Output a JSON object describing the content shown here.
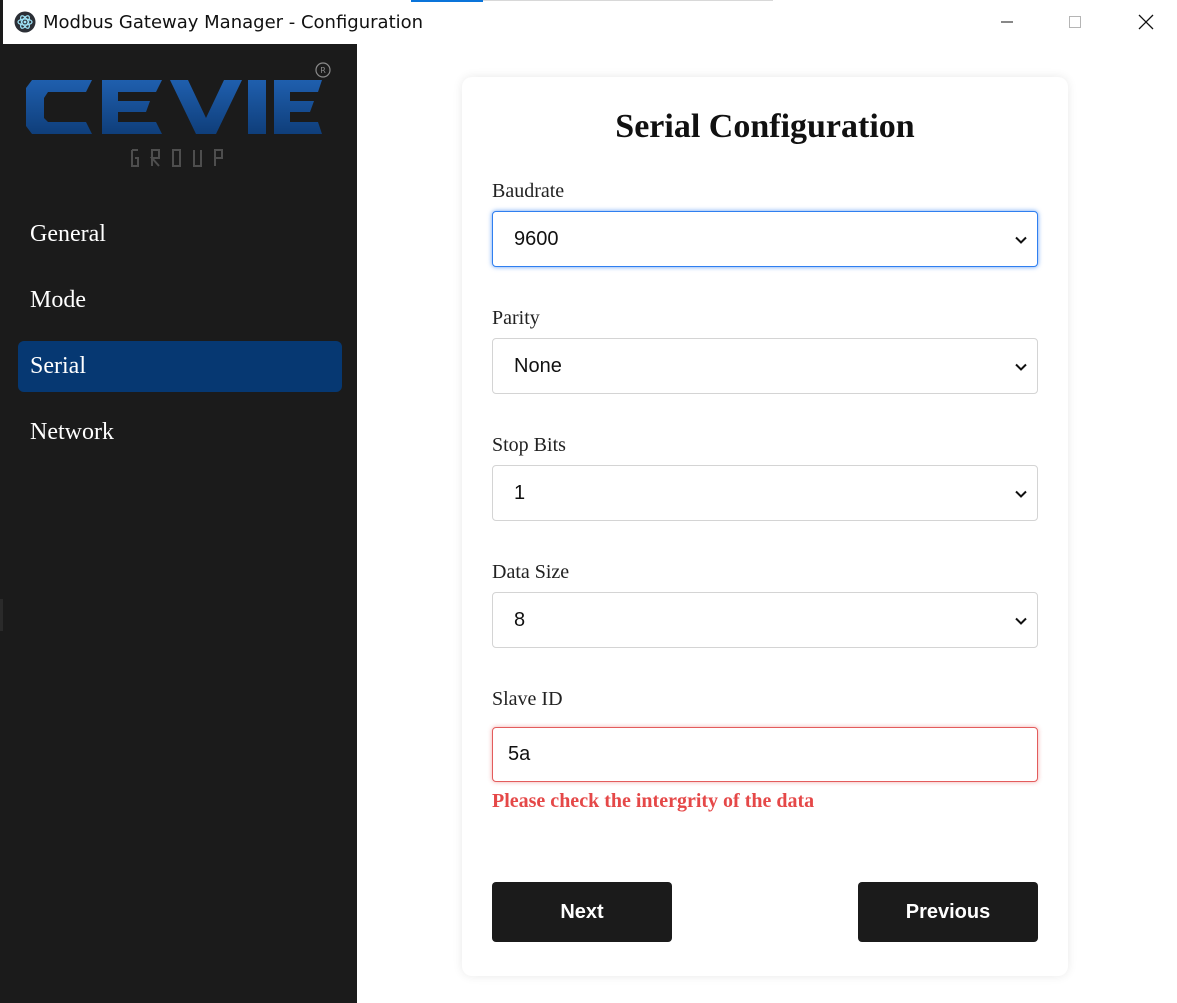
{
  "window": {
    "title": "Modbus Gateway Manager - Configuration",
    "icons": [
      "app-icon",
      "minimize-icon",
      "maximize-icon",
      "close-icon"
    ]
  },
  "sidebar": {
    "logo_text": "CEVIE",
    "logo_subtext": "GROUP",
    "items": [
      {
        "label": "General"
      },
      {
        "label": "Mode"
      },
      {
        "label": "Serial",
        "active": true
      },
      {
        "label": "Network"
      }
    ],
    "active_color": "#063872"
  },
  "form": {
    "title": "Serial Configuration",
    "baudrate": {
      "label": "Baudrate",
      "value": "9600"
    },
    "parity": {
      "label": "Parity",
      "value": "None"
    },
    "stop_bits": {
      "label": "Stop Bits",
      "value": "1"
    },
    "data_size": {
      "label": "Data Size",
      "value": "8"
    },
    "slave_id": {
      "label": "Slave ID",
      "value": "5a"
    },
    "error": "Please check the intergrity of the data",
    "next_label": "Next",
    "previous_label": "Previous"
  },
  "colors": {
    "sidebar_bg": "#1b1b1b",
    "focus_blue": "#2f7ff0",
    "error_red": "#e54848",
    "button_bg": "#1b1b1b"
  }
}
